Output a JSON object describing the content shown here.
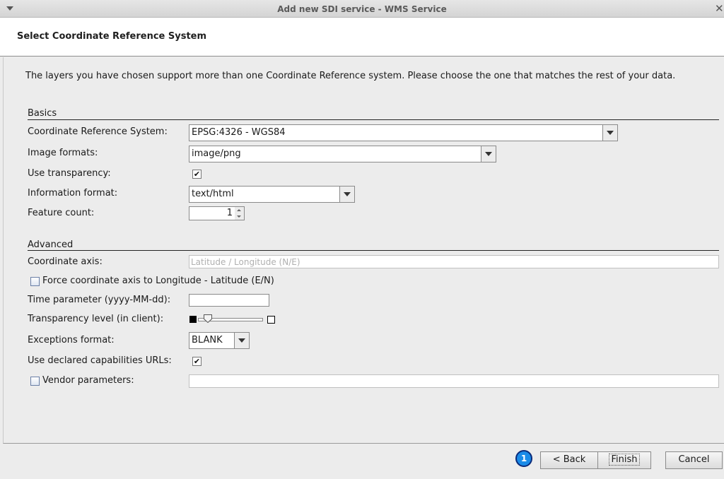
{
  "window": {
    "title": "Add new SDI service - WMS Service"
  },
  "header": {
    "title": "Select Coordinate Reference System"
  },
  "intro_text": "The layers you have chosen support more than one Coordinate Reference system. Please choose the one that matches the rest of your data.",
  "basics": {
    "section_title": "Basics",
    "crs_label": "Coordinate Reference System:",
    "crs_value": "EPSG:4326 - WGS84",
    "image_formats_label": "Image formats:",
    "image_formats_value": "image/png",
    "use_transparency_label": "Use transparency:",
    "use_transparency_checked": true,
    "info_format_label": "Information format:",
    "info_format_value": "text/html",
    "feature_count_label": "Feature count:",
    "feature_count_value": "1"
  },
  "advanced": {
    "section_title": "Advanced",
    "coord_axis_label": "Coordinate axis:",
    "coord_axis_value": "Latitude / Longitude (N/E)",
    "force_axis_label": "Force coordinate axis to Longitude - Latitude (E/N)",
    "force_axis_checked": false,
    "time_param_label": "Time parameter (yyyy-MM-dd):",
    "time_param_value": "",
    "transparency_level_label": "Transparency level (in client):",
    "transparency_level": 0.15,
    "exceptions_format_label": "Exceptions format:",
    "exceptions_format_value": "BLANK",
    "declared_urls_label": "Use declared capabilities URLs:",
    "declared_urls_checked": true,
    "vendor_params_label": "Vendor parameters:",
    "vendor_params_checked": false,
    "vendor_params_value": ""
  },
  "buttons": {
    "back": "< Back",
    "finish": "Finish",
    "cancel": "Cancel",
    "marker": "1"
  },
  "check_glyph": "✔"
}
